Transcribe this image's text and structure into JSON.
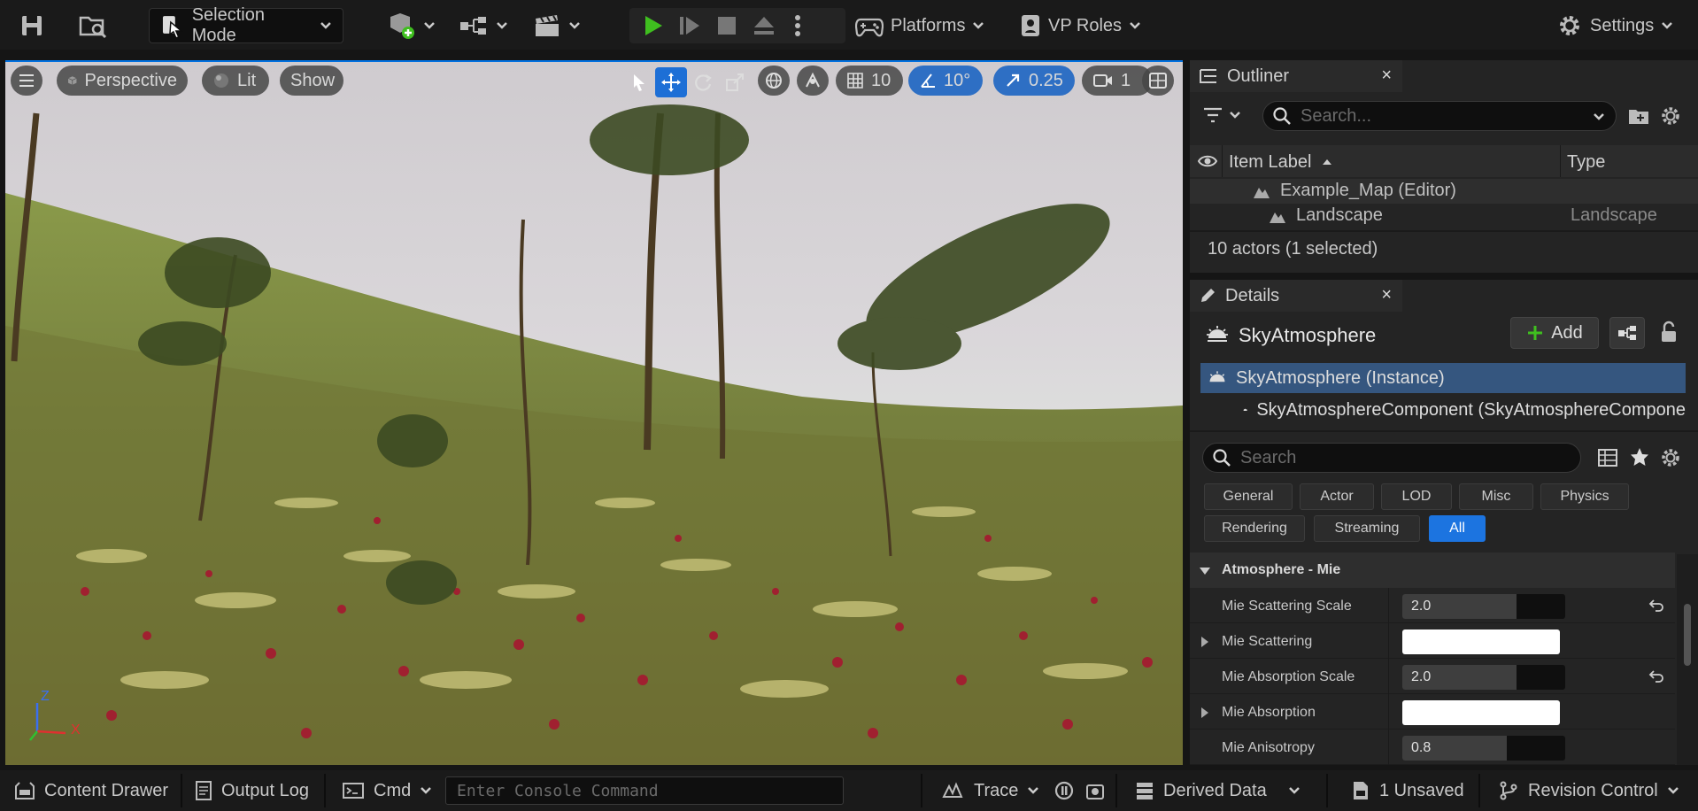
{
  "toolbar": {
    "selection_mode": "Selection Mode",
    "platforms": "Platforms",
    "vp_roles": "VP Roles",
    "settings": "Settings"
  },
  "viewport": {
    "perspective": "Perspective",
    "lit": "Lit",
    "show": "Show",
    "grid_size": "10",
    "rotation_snap": "10°",
    "scale_snap": "0.25",
    "camera_speed": "1",
    "axis_labels": {
      "z": "Z",
      "x": "X"
    }
  },
  "outliner": {
    "title": "Outliner",
    "search_placeholder": "Search...",
    "col_label": "Item Label",
    "col_type": "Type",
    "rows": [
      {
        "label": "Example_Map (Editor)",
        "type": ""
      },
      {
        "label": "Landscape",
        "type": "Landscape"
      }
    ],
    "status": "10 actors (1 selected)"
  },
  "details": {
    "title": "Details",
    "actor_name": "SkyAtmosphere",
    "add_label": "Add",
    "components": [
      "SkyAtmosphere (Instance)",
      "SkyAtmosphereComponent (SkyAtmosphereCompone"
    ],
    "search_placeholder": "Search",
    "filters": [
      "General",
      "Actor",
      "LOD",
      "Misc",
      "Physics",
      "Rendering",
      "Streaming",
      "All"
    ],
    "active_filter": "All",
    "section": "Atmosphere - Mie",
    "properties": [
      {
        "label": "Mie Scattering Scale",
        "value": "2.0",
        "fraction": 0.7
      },
      {
        "label": "Mie Scattering",
        "value": ""
      },
      {
        "label": "Mie Absorption Scale",
        "value": "2.0",
        "fraction": 0.7
      },
      {
        "label": "Mie Absorption",
        "value": ""
      },
      {
        "label": "Mie Anisotropy",
        "value": "0.8",
        "fraction": 0.64
      }
    ]
  },
  "statusbar": {
    "content_drawer": "Content Drawer",
    "output_log": "Output Log",
    "cmd": "Cmd",
    "console_placeholder": "Enter Console Command",
    "trace": "Trace",
    "derived_data": "Derived Data",
    "unsaved": "1 Unsaved",
    "revision_control": "Revision Control"
  },
  "colors": {
    "accent": "#1c74e0",
    "play": "#3fbf1f",
    "panel": "#242424"
  }
}
